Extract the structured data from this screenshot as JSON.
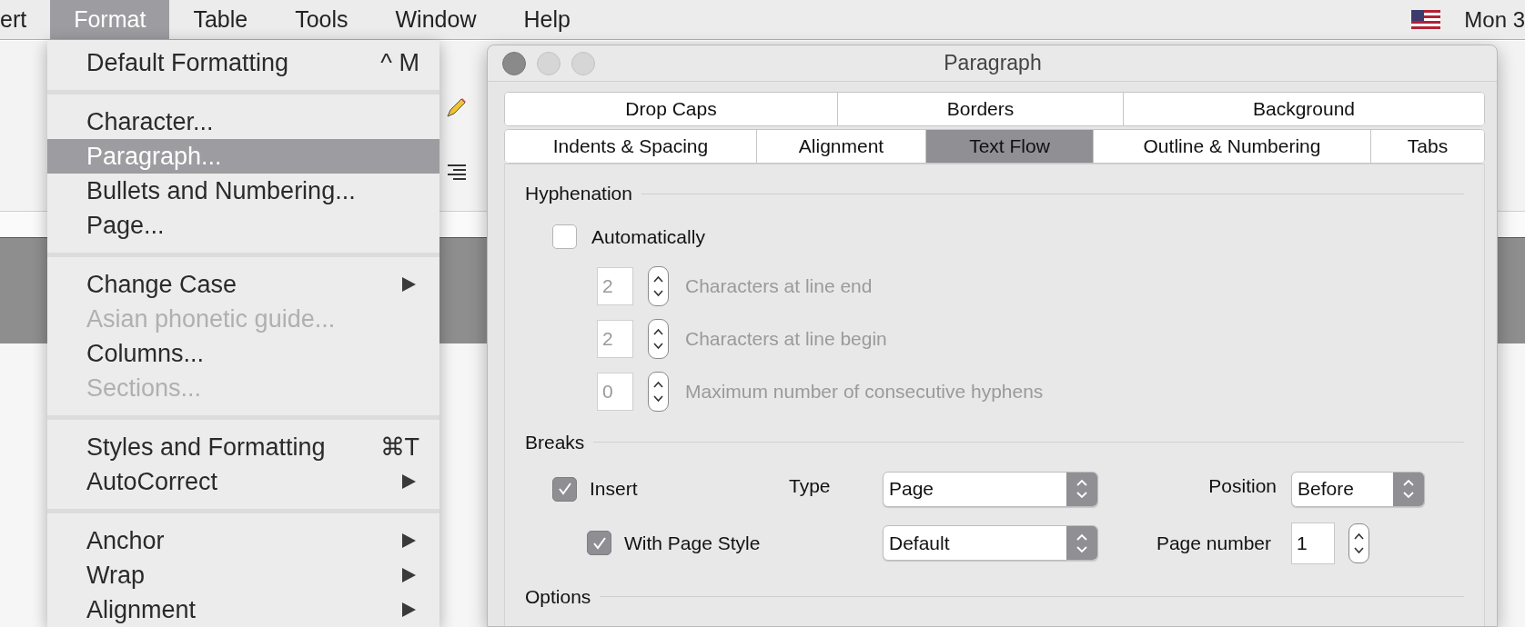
{
  "menu_bar": {
    "items": [
      {
        "label": "ert",
        "selected": false
      },
      {
        "label": "Format",
        "selected": true
      },
      {
        "label": "Table",
        "selected": false
      },
      {
        "label": "Tools",
        "selected": false
      },
      {
        "label": "Window",
        "selected": false
      },
      {
        "label": "Help",
        "selected": false
      }
    ],
    "clock": "Mon 3"
  },
  "format_menu": {
    "items": [
      {
        "kind": "item",
        "label": "Default Formatting",
        "shortcut": "^ M",
        "disabled": false,
        "selected": false,
        "submenu": false
      },
      {
        "kind": "separator"
      },
      {
        "kind": "item",
        "label": "Character...",
        "disabled": false,
        "selected": false,
        "submenu": false
      },
      {
        "kind": "item",
        "label": "Paragraph...",
        "disabled": false,
        "selected": true,
        "submenu": false
      },
      {
        "kind": "item",
        "label": "Bullets and Numbering...",
        "disabled": false,
        "selected": false,
        "submenu": false
      },
      {
        "kind": "item",
        "label": "Page...",
        "disabled": false,
        "selected": false,
        "submenu": false
      },
      {
        "kind": "separator"
      },
      {
        "kind": "item",
        "label": "Change Case",
        "disabled": false,
        "selected": false,
        "submenu": true
      },
      {
        "kind": "item",
        "label": "Asian phonetic guide...",
        "disabled": true,
        "selected": false,
        "submenu": false
      },
      {
        "kind": "item",
        "label": "Columns...",
        "disabled": false,
        "selected": false,
        "submenu": false
      },
      {
        "kind": "item",
        "label": "Sections...",
        "disabled": true,
        "selected": false,
        "submenu": false
      },
      {
        "kind": "separator"
      },
      {
        "kind": "item",
        "label": "Styles and Formatting",
        "shortcut": "⌘T",
        "disabled": false,
        "selected": false,
        "submenu": false
      },
      {
        "kind": "item",
        "label": "AutoCorrect",
        "disabled": false,
        "selected": false,
        "submenu": true
      },
      {
        "kind": "separator"
      },
      {
        "kind": "item",
        "label": "Anchor",
        "disabled": false,
        "selected": false,
        "submenu": true
      },
      {
        "kind": "item",
        "label": "Wrap",
        "disabled": false,
        "selected": false,
        "submenu": true
      },
      {
        "kind": "item",
        "label": "Alignment",
        "disabled": false,
        "selected": false,
        "submenu": true
      }
    ]
  },
  "dialog": {
    "title": "Paragraph",
    "tab_rows": [
      [
        {
          "label": "Drop Caps",
          "selected": false
        },
        {
          "label": "Borders",
          "selected": false
        },
        {
          "label": "Background",
          "selected": false
        }
      ],
      [
        {
          "label": "Indents & Spacing",
          "selected": false
        },
        {
          "label": "Alignment",
          "selected": false
        },
        {
          "label": "Text Flow",
          "selected": true
        },
        {
          "label": "Outline & Numbering",
          "selected": false
        },
        {
          "label": "Tabs",
          "selected": false
        }
      ]
    ],
    "hyphenation": {
      "title": "Hyphenation",
      "automatic": {
        "label": "Automatically",
        "checked": false
      },
      "spins": [
        {
          "value": "2",
          "label": "Characters at line end",
          "disabled": true
        },
        {
          "value": "2",
          "label": "Characters at line begin",
          "disabled": true
        },
        {
          "value": "0",
          "label": "Maximum number of consecutive hyphens",
          "disabled": true
        }
      ]
    },
    "breaks": {
      "title": "Breaks",
      "insert": {
        "label": "Insert",
        "checked": true
      },
      "with_page_style": {
        "label": "With Page Style",
        "checked": true
      },
      "type": {
        "label": "Type",
        "value": "Page"
      },
      "style": {
        "value": "Default"
      },
      "position": {
        "label": "Position",
        "value": "Before"
      },
      "page_number": {
        "label": "Page number",
        "value": "1"
      }
    },
    "options": {
      "title": "Options"
    }
  }
}
